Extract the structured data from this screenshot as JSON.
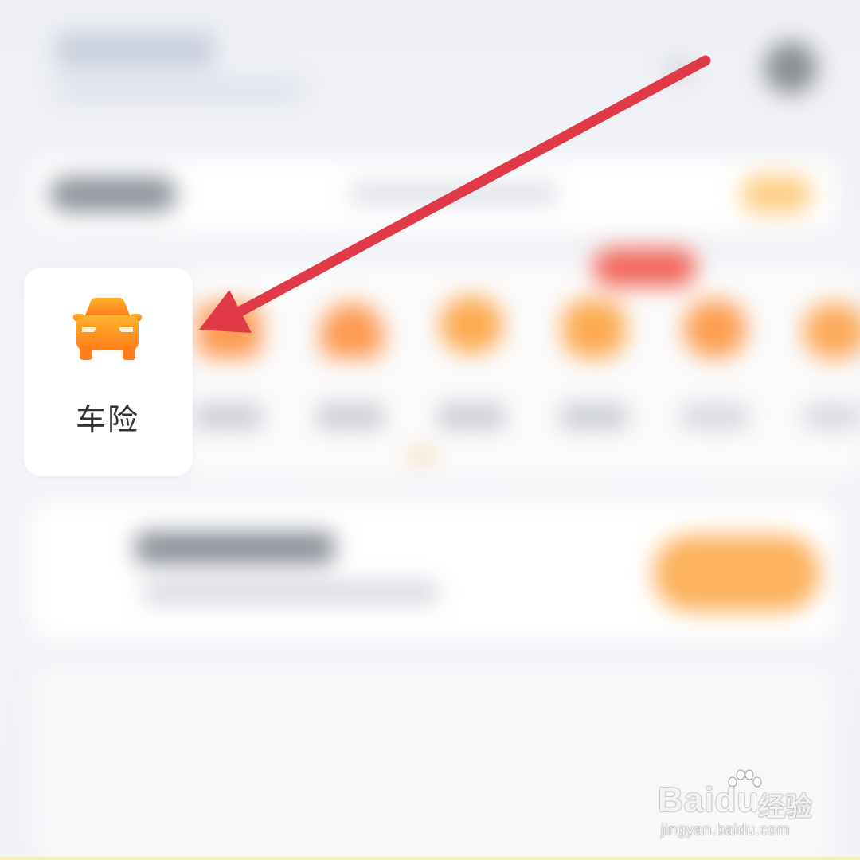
{
  "screen": {
    "insurance_grid": {
      "focused_item": {
        "label": "车险",
        "icon": "car-icon"
      }
    },
    "annotation": {
      "icon": "red-arrow-icon",
      "color": "#e03a46"
    }
  },
  "watermark": {
    "brand": "Bai",
    "brand_du": "du",
    "product": "经验",
    "url": "jingyan.baidu.com"
  },
  "colors": {
    "accent_orange": "#ff8a1f",
    "arrow_red": "#e03a46",
    "card_bg": "#ffffff",
    "page_bg": "#f3f4f7"
  }
}
